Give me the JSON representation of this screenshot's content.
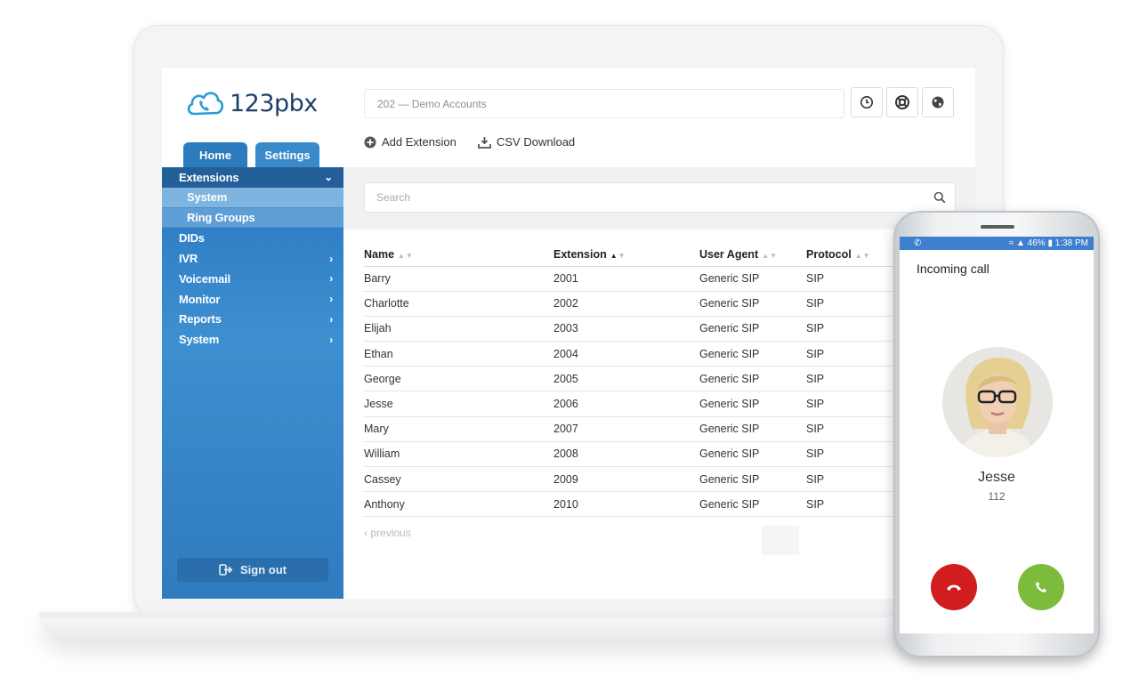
{
  "brand": {
    "name": "123pbx"
  },
  "tabs": [
    {
      "label": "Home",
      "active": true
    },
    {
      "label": "Settings",
      "active": false
    }
  ],
  "account": {
    "selected": "202  —  Demo Accounts"
  },
  "actions": {
    "add_extension": "Add Extension",
    "csv_download": "CSV Download"
  },
  "sidebar": {
    "items": [
      {
        "label": "Extensions",
        "icon": "chevron-down-icon",
        "open": true
      },
      {
        "label": "System",
        "sub": true,
        "active": true
      },
      {
        "label": "Ring Groups",
        "sub": true
      },
      {
        "label": "DIDs"
      },
      {
        "label": "IVR",
        "icon": "chevron-right-icon"
      },
      {
        "label": "Voicemail",
        "icon": "chevron-right-icon"
      },
      {
        "label": "Monitor",
        "icon": "chevron-right-icon"
      },
      {
        "label": "Reports",
        "icon": "chevron-right-icon"
      },
      {
        "label": "System",
        "icon": "chevron-right-icon"
      }
    ],
    "signout": "Sign out"
  },
  "search": {
    "placeholder": "Search"
  },
  "table": {
    "columns": [
      "Name",
      "Extension",
      "User Agent",
      "Protocol"
    ],
    "sorted_column": "Extension",
    "rows": [
      [
        "Barry",
        "2001",
        "Generic SIP",
        "SIP"
      ],
      [
        "Charlotte",
        "2002",
        "Generic SIP",
        "SIP"
      ],
      [
        "Elijah",
        "2003",
        "Generic SIP",
        "SIP"
      ],
      [
        "Ethan",
        "2004",
        "Generic SIP",
        "SIP"
      ],
      [
        "George",
        "2005",
        "Generic SIP",
        "SIP"
      ],
      [
        "Jesse",
        "2006",
        "Generic SIP",
        "SIP"
      ],
      [
        "Mary",
        "2007",
        "Generic SIP",
        "SIP"
      ],
      [
        "William",
        "2008",
        "Generic SIP",
        "SIP"
      ],
      [
        "Cassey",
        "2009",
        "Generic SIP",
        "SIP"
      ],
      [
        "Anthony",
        "2010",
        "Generic SIP",
        "SIP"
      ]
    ],
    "pagination_prev": "previous"
  },
  "phone": {
    "status": {
      "battery": "46%",
      "time": "1:38 PM"
    },
    "title": "Incoming call",
    "caller_name": "Jesse",
    "caller_number": "112"
  },
  "colors": {
    "sidebar": "#2f7fc6",
    "decline": "#d11d1d",
    "accept": "#7dbb3c"
  }
}
